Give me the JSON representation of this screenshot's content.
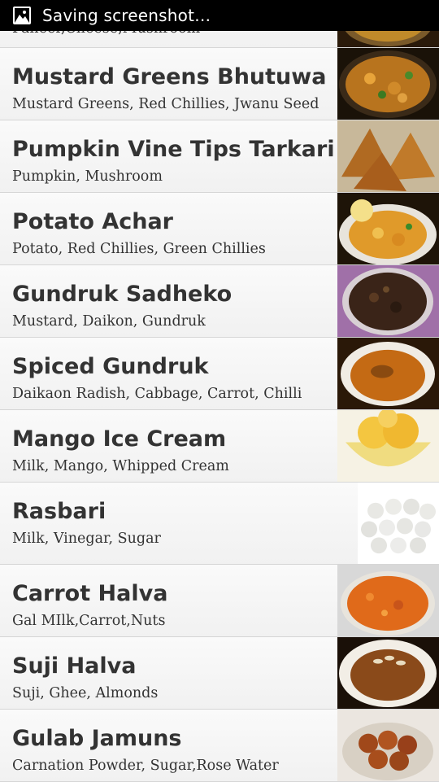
{
  "status_bar": {
    "text": "Saving screenshot…",
    "icon": "image-icon"
  },
  "recipes": [
    {
      "title": "",
      "ingredients": "Paneer,Cheese,Mushroom",
      "image": "curry-dish"
    },
    {
      "title": "Mustard Greens Bhutuwa",
      "ingredients": "Mustard Greens, Red Chillies, Jwanu Seed",
      "image": "greens-curry"
    },
    {
      "title": "Pumpkin Vine Tips Tarkari",
      "ingredients": "Pumpkin, Mushroom",
      "image": "samosa"
    },
    {
      "title": "Potato Achar",
      "ingredients": "Potato, Red Chillies, Green Chillies",
      "image": "potato-achar"
    },
    {
      "title": "Gundruk Sadheko",
      "ingredients": "Mustard, Daikon, Gundruk",
      "image": "gundruk-bowl"
    },
    {
      "title": "Spiced Gundruk",
      "ingredients": "Daikaon Radish, Cabbage, Carrot, Chilli",
      "image": "soup-bowl"
    },
    {
      "title": "Mango Ice Cream",
      "ingredients": "Milk, Mango, Whipped Cream",
      "image": "mango-ice-cream"
    },
    {
      "title": "Rasbari",
      "ingredients": "Milk, Vinegar, Sugar",
      "image": "rasbari"
    },
    {
      "title": "Carrot Halva",
      "ingredients": "Gal MIlk,Carrot,Nuts",
      "image": "carrot-halva"
    },
    {
      "title": "Suji Halva",
      "ingredients": "Suji, Ghee, Almonds",
      "image": "suji-halva"
    },
    {
      "title": "Gulab Jamuns",
      "ingredients": "Carnation Powder, Sugar,Rose Water",
      "image": "gulab-jamun"
    }
  ]
}
